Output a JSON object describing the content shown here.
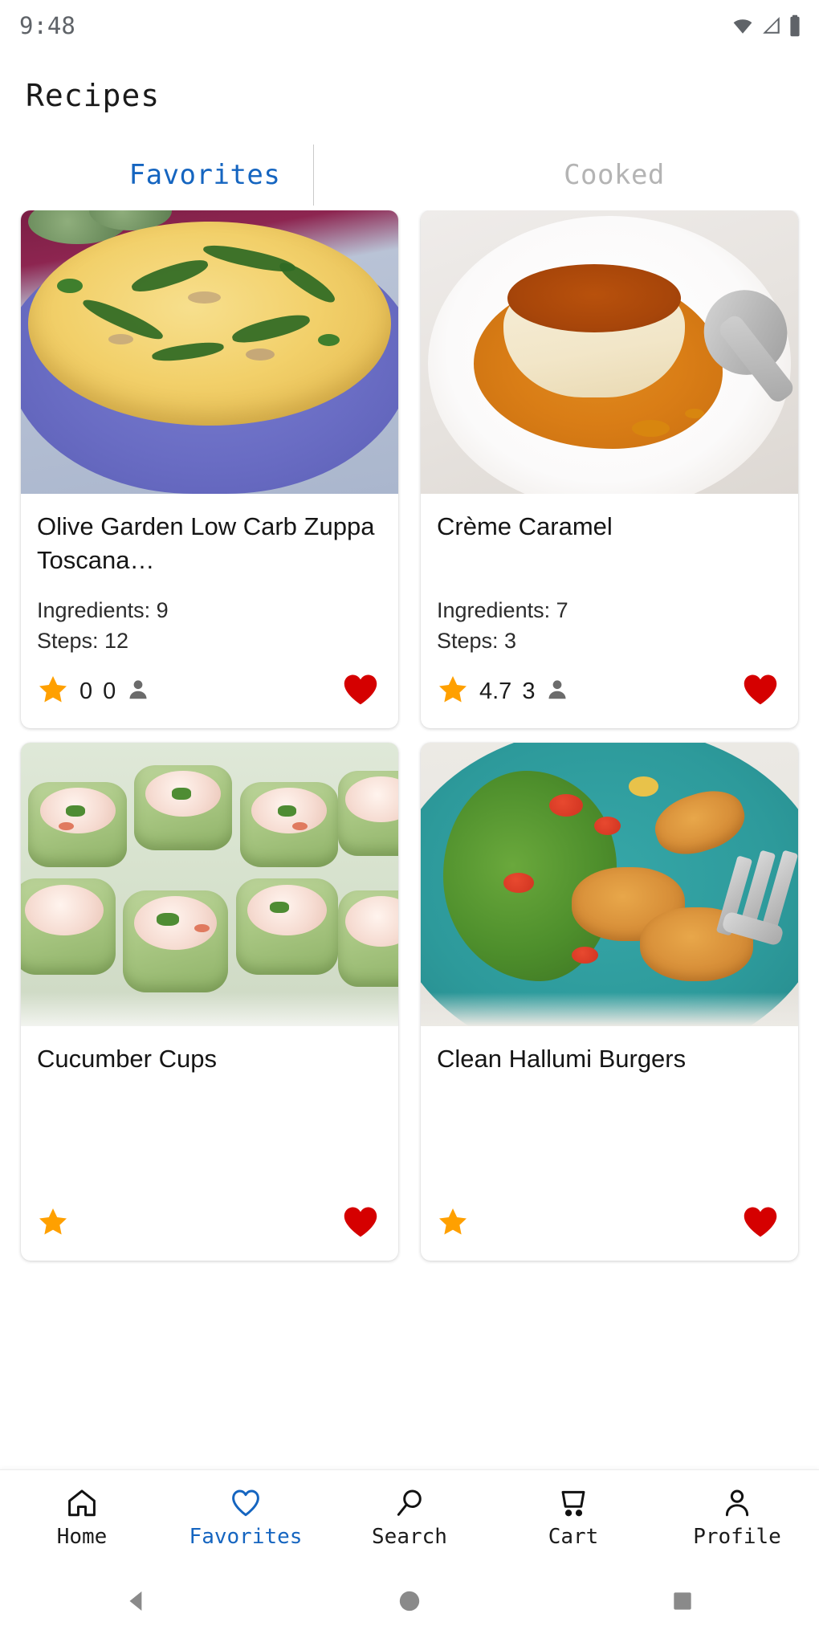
{
  "status_bar": {
    "time": "9:48",
    "icons": [
      "wifi-icon",
      "cellular-signal-icon",
      "battery-icon"
    ]
  },
  "header": {
    "title": "Recipes"
  },
  "tabs": {
    "active_color": "#1565C0",
    "inactive_color": "#b4b4b4",
    "items": [
      {
        "label": "Favorites",
        "active": true
      },
      {
        "label": "Cooked",
        "active": false
      }
    ]
  },
  "recipes": [
    {
      "title": "Olive Garden Low Carb Zuppa Toscana…",
      "ingredients_label": "Ingredients: 9",
      "steps_label": "Steps: 12",
      "rating": "0",
      "review_count": "0",
      "favorited": true,
      "image": "soup-in-blue-pot"
    },
    {
      "title": "Crème Caramel",
      "ingredients_label": "Ingredients: 7",
      "steps_label": "Steps: 3",
      "rating": "4.7",
      "review_count": "3",
      "favorited": true,
      "image": "creme-caramel-on-plate"
    },
    {
      "title": "Cucumber Cups",
      "ingredients_label": "",
      "steps_label": "",
      "rating": "",
      "review_count": "",
      "favorited": true,
      "image": "cucumber-cups"
    },
    {
      "title": "Clean Hallumi Burgers",
      "ingredients_label": "",
      "steps_label": "",
      "rating": "",
      "review_count": "",
      "favorited": true,
      "image": "halloumi-burgers-on-teal-plate"
    }
  ],
  "icons": {
    "star": "star-icon",
    "person": "person-icon",
    "heart": "heart-icon",
    "star_color": "#FFA000",
    "heart_color": "#D50000",
    "person_color": "#6b6b6b"
  },
  "bottom_nav": {
    "active_color": "#1565C0",
    "items": [
      {
        "label": "Home",
        "icon": "home-icon",
        "active": false
      },
      {
        "label": "Favorites",
        "icon": "heart-outline-icon",
        "active": true
      },
      {
        "label": "Search",
        "icon": "search-icon",
        "active": false
      },
      {
        "label": "Cart",
        "icon": "cart-icon",
        "active": false
      },
      {
        "label": "Profile",
        "icon": "person-outline-icon",
        "active": false
      }
    ]
  },
  "system_nav": {
    "items": [
      {
        "icon": "back-triangle-icon"
      },
      {
        "icon": "home-circle-icon"
      },
      {
        "icon": "recents-square-icon"
      }
    ]
  }
}
